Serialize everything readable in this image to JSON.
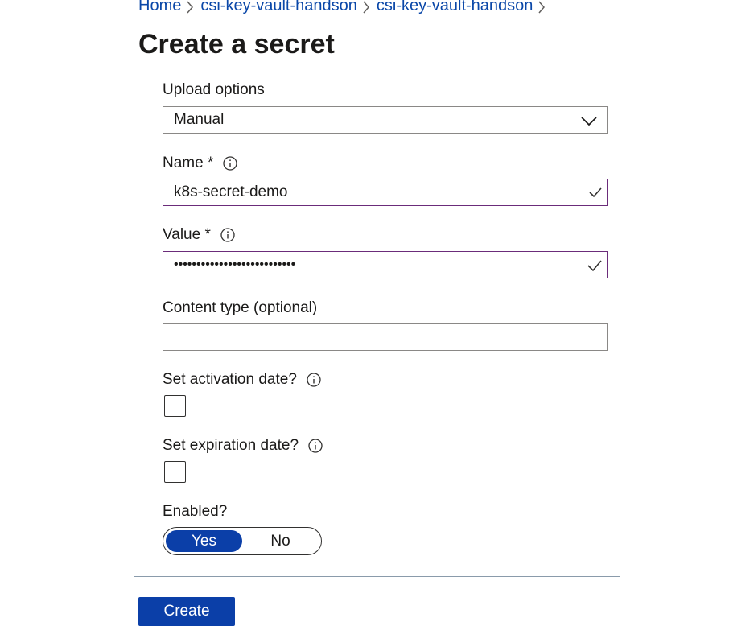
{
  "breadcrumb": {
    "items": [
      "Home",
      "csi-key-vault-handson",
      "csi-key-vault-handson"
    ]
  },
  "page": {
    "title": "Create a secret"
  },
  "form": {
    "upload_options": {
      "label": "Upload options",
      "value": "Manual"
    },
    "name": {
      "label": "Name *",
      "value": "k8s-secret-demo"
    },
    "value": {
      "label": "Value *",
      "masked_value": "•••••••••••••••••••••••••••"
    },
    "content_type": {
      "label": "Content type (optional)",
      "value": ""
    },
    "activation_date": {
      "label": "Set activation date?",
      "checked": false
    },
    "expiration_date": {
      "label": "Set expiration date?",
      "checked": false
    },
    "enabled": {
      "label": "Enabled?",
      "yes_label": "Yes",
      "no_label": "No",
      "selected": "Yes"
    }
  },
  "actions": {
    "create_label": "Create"
  },
  "colors": {
    "accent": "#0b3fa8",
    "link": "#0a47a8",
    "valid_border": "#6b2c7a"
  }
}
